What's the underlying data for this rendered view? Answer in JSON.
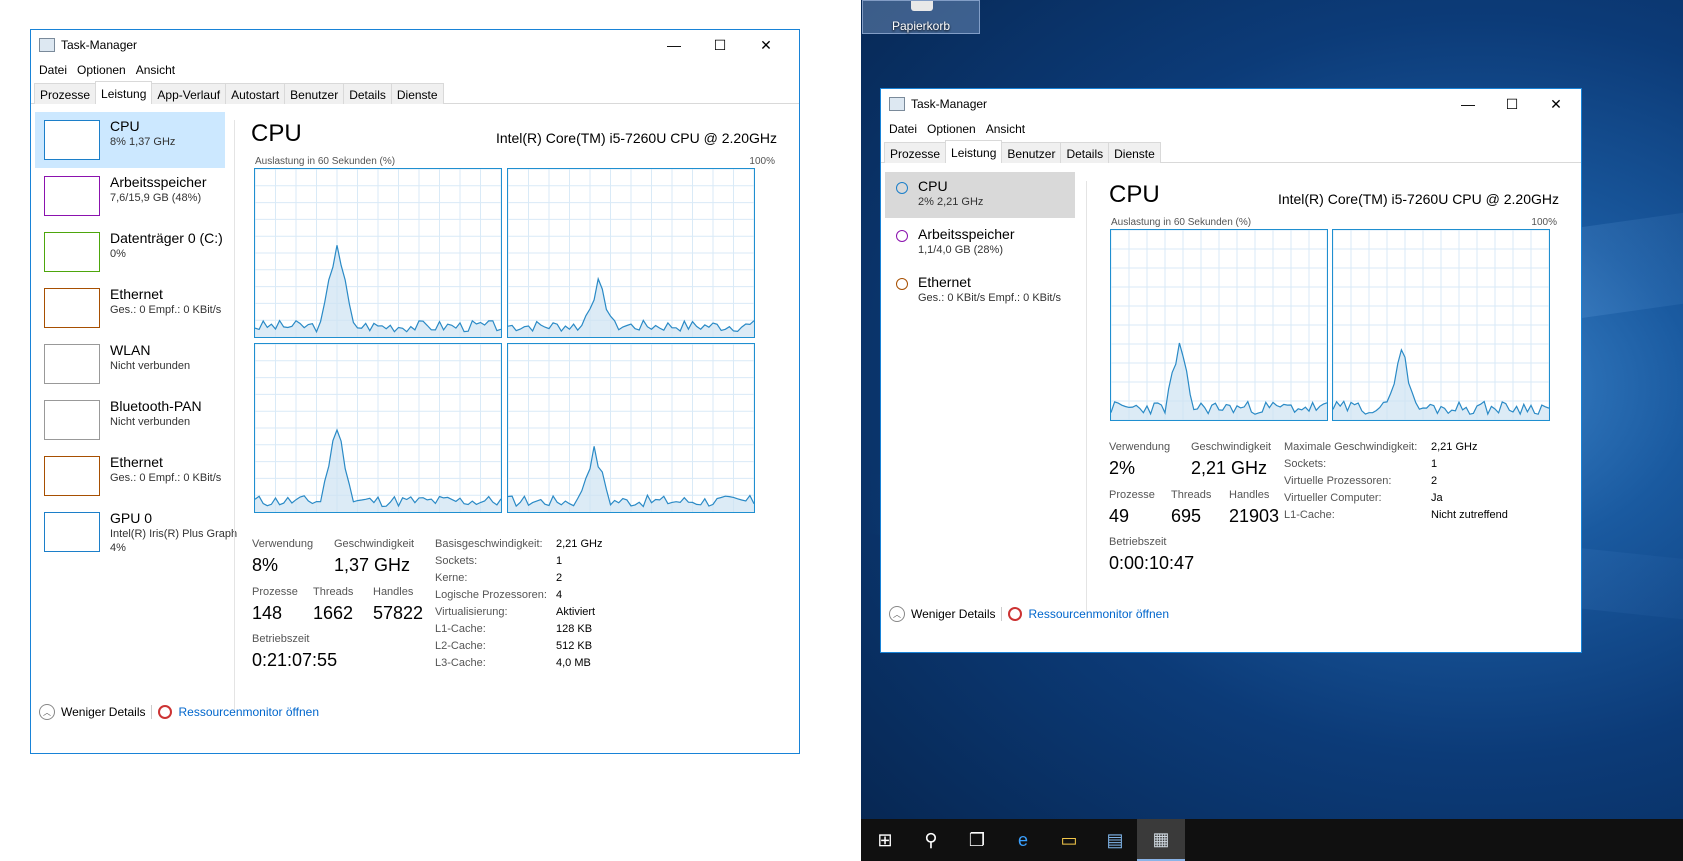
{
  "desktop": {
    "recycle_bin_label": "Papierkorb",
    "taskbar_items": [
      "start-icon",
      "search-icon",
      "task-view-icon",
      "edge-icon",
      "explorer-icon",
      "server-manager-icon",
      "task-manager-icon"
    ]
  },
  "win1": {
    "title": "Task-Manager",
    "controls": {
      "minimize": "—",
      "maximize": "☐",
      "close": "✕"
    },
    "menu": [
      "Datei",
      "Optionen",
      "Ansicht"
    ],
    "tabs": [
      "Prozesse",
      "Leistung",
      "App-Verlauf",
      "Autostart",
      "Benutzer",
      "Details",
      "Dienste"
    ],
    "selected_tab": "Leistung",
    "sidebar": [
      {
        "name": "CPU",
        "sub": "8%  1,37 GHz",
        "color": "#1c7fc9"
      },
      {
        "name": "Arbeitsspeicher",
        "sub": "7,6/15,9 GB (48%)",
        "color": "#8b12ae"
      },
      {
        "name": "Datenträger 0 (C:)",
        "sub": "0%",
        "color": "#4da60c"
      },
      {
        "name": "Ethernet",
        "sub": "Ges.: 0  Empf.: 0 KBit/s",
        "color": "#a74f01"
      },
      {
        "name": "WLAN",
        "sub": "Nicht verbunden",
        "color": "#999999"
      },
      {
        "name": "Bluetooth-PAN",
        "sub": "Nicht verbunden",
        "color": "#999999"
      },
      {
        "name": "Ethernet",
        "sub": "Ges.: 0  Empf.: 0 KBit/s",
        "color": "#a74f01"
      },
      {
        "name": "GPU 0",
        "sub": "Intel(R) Iris(R) Plus Graph",
        "sub2": "4%",
        "color": "#1c7fc9"
      }
    ],
    "main": {
      "title": "CPU",
      "cpu_name": "Intel(R) Core(TM) i5-7260U CPU @ 2.20GHz",
      "graph_label": "Auslastung in 60 Sekunden (%)",
      "graph_max": "100%",
      "stats": {
        "verwendung_label": "Verwendung",
        "verwendung": "8%",
        "geschwindigkeit_label": "Geschwindigkeit",
        "geschwindigkeit": "1,37 GHz",
        "prozesse_label": "Prozesse",
        "prozesse": "148",
        "threads_label": "Threads",
        "threads": "1662",
        "handles_label": "Handles",
        "handles": "57822",
        "betriebszeit_label": "Betriebszeit",
        "betriebszeit": "0:21:07:55"
      },
      "details": [
        [
          "Basisgeschwindigkeit:",
          "2,21 GHz"
        ],
        [
          "Sockets:",
          "1"
        ],
        [
          "Kerne:",
          "2"
        ],
        [
          "Logische Prozessoren:",
          "4"
        ],
        [
          "Virtualisierung:",
          "Aktiviert"
        ],
        [
          "L1-Cache:",
          "128 KB"
        ],
        [
          "L2-Cache:",
          "512 KB"
        ],
        [
          "L3-Cache:",
          "4,0 MB"
        ]
      ]
    },
    "footer": {
      "less": "Weniger Details",
      "monitor": "Ressourcenmonitor öffnen"
    }
  },
  "win2": {
    "title": "Task-Manager",
    "controls": {
      "minimize": "—",
      "maximize": "☐",
      "close": "✕"
    },
    "menu": [
      "Datei",
      "Optionen",
      "Ansicht"
    ],
    "tabs": [
      "Prozesse",
      "Leistung",
      "Benutzer",
      "Details",
      "Dienste"
    ],
    "selected_tab": "Leistung",
    "sidebar": [
      {
        "name": "CPU",
        "sub": "2%  2,21 GHz",
        "color": "#1c7fc9"
      },
      {
        "name": "Arbeitsspeicher",
        "sub": "1,1/4,0 GB (28%)",
        "color": "#8b12ae"
      },
      {
        "name": "Ethernet",
        "sub": "Ges.: 0 KBit/s  Empf.: 0 KBit/s",
        "color": "#a74f01"
      }
    ],
    "main": {
      "title": "CPU",
      "cpu_name": "Intel(R) Core(TM) i5-7260U CPU @ 2.20GHz",
      "graph_label": "Auslastung in 60 Sekunden (%)",
      "graph_max": "100%",
      "stats": {
        "verwendung_label": "Verwendung",
        "verwendung": "2%",
        "geschwindigkeit_label": "Geschwindigkeit",
        "geschwindigkeit": "2,21 GHz",
        "prozesse_label": "Prozesse",
        "prozesse": "49",
        "threads_label": "Threads",
        "threads": "695",
        "handles_label": "Handles",
        "handles": "21903",
        "betriebszeit_label": "Betriebszeit",
        "betriebszeit": "0:00:10:47"
      },
      "details": [
        [
          "Maximale Geschwindigkeit:",
          "2,21 GHz"
        ],
        [
          "Sockets:",
          "1"
        ],
        [
          "Virtuelle Prozessoren:",
          "2"
        ],
        [
          "Virtueller Computer:",
          "Ja"
        ],
        [
          "L1-Cache:",
          "Nicht zutreffend"
        ]
      ]
    },
    "footer": {
      "less": "Weniger Details",
      "monitor": "Ressourcenmonitor öffnen"
    }
  }
}
